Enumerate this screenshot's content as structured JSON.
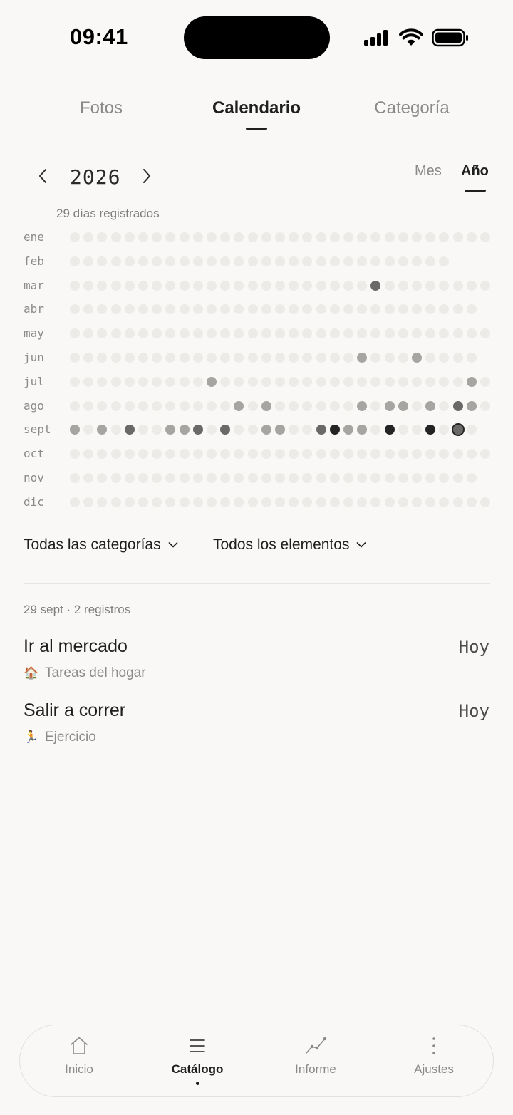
{
  "status": {
    "time": "09:41"
  },
  "tabs": [
    {
      "label": "Fotos",
      "active": false
    },
    {
      "label": "Calendario",
      "active": true
    },
    {
      "label": "Categoría",
      "active": false
    }
  ],
  "calendar": {
    "year": "2026",
    "view_options": [
      {
        "label": "Mes",
        "active": false
      },
      {
        "label": "Año",
        "active": true
      }
    ],
    "days_count_label": "29 días registrados",
    "months": [
      {
        "label": "ene",
        "days": 31,
        "active": {}
      },
      {
        "label": "feb",
        "days": 28,
        "active": {}
      },
      {
        "label": "mar",
        "days": 31,
        "active": {
          "23": 2
        }
      },
      {
        "label": "abr",
        "days": 30,
        "active": {}
      },
      {
        "label": "may",
        "days": 31,
        "active": {}
      },
      {
        "label": "jun",
        "days": 30,
        "active": {
          "22": 1,
          "26": 1
        }
      },
      {
        "label": "jul",
        "days": 31,
        "active": {
          "11": 1,
          "30": 1
        }
      },
      {
        "label": "ago",
        "days": 31,
        "active": {
          "13": 1,
          "15": 1,
          "22": 1,
          "24": 1,
          "25": 1,
          "27": 1,
          "29": 2,
          "30": 1
        }
      },
      {
        "label": "sept",
        "days": 30,
        "active": {
          "1": 1,
          "3": 1,
          "5": 2,
          "8": 1,
          "9": 1,
          "10": 2,
          "12": 2,
          "15": 1,
          "16": 1,
          "19": 2,
          "20": 3,
          "21": 1,
          "22": 1,
          "24": 3,
          "27": 3,
          "29": 2
        },
        "today": 29
      },
      {
        "label": "oct",
        "days": 31,
        "active": {}
      },
      {
        "label": "nov",
        "days": 30,
        "active": {}
      },
      {
        "label": "dic",
        "days": 31,
        "active": {}
      }
    ]
  },
  "filters": {
    "categories_label": "Todas las categorías",
    "elements_label": "Todos los elementos"
  },
  "records": {
    "header": "29 sept · 2 registros",
    "items": [
      {
        "title": "Ir al mercado",
        "date": "Hoy",
        "category_emoji": "🏠",
        "category": "Tareas del hogar"
      },
      {
        "title": "Salir a correr",
        "date": "Hoy",
        "category_emoji": "🏃",
        "category": "Ejercicio"
      }
    ]
  },
  "bottom_nav": [
    {
      "label": "Inicio",
      "icon": "home-icon",
      "active": false
    },
    {
      "label": "Catálogo",
      "icon": "list-icon",
      "active": true
    },
    {
      "label": "Informe",
      "icon": "trend-icon",
      "active": false
    },
    {
      "label": "Ajustes",
      "icon": "more-vertical-icon",
      "active": false
    }
  ],
  "colors": {
    "background": "#f9f8f6",
    "level0": "#ecebe8",
    "level1": "#a6a5a2",
    "level2": "#6a6967",
    "level3": "#242424"
  }
}
